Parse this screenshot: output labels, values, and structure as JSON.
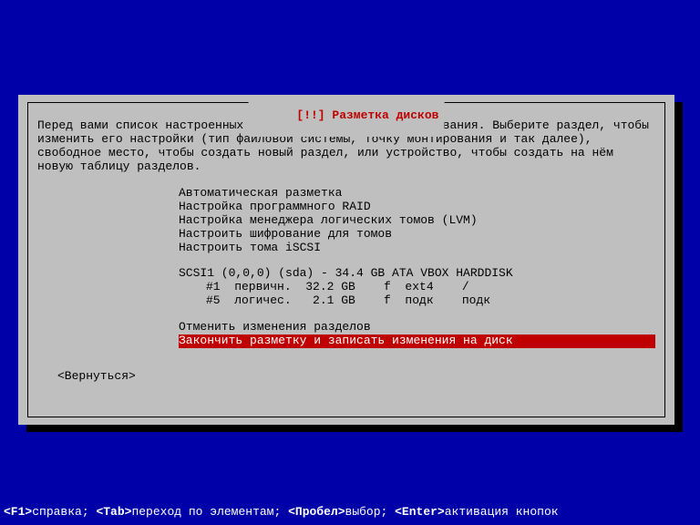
{
  "dialog": {
    "title": "[!!] Разметка дисков",
    "intro": "Перед вами список настроенных разделов и их точек монтирования. Выберите раздел, чтобы изменить его настройки (тип файловой системы, точку монтирования и так далее), свободное место, чтобы создать новый раздел, или устройство, чтобы создать на нём новую таблицу разделов.",
    "menu": {
      "auto": "Автоматическая разметка",
      "raid": "Настройка программного RAID",
      "lvm": "Настройка менеджера логических томов (LVM)",
      "encrypt": "Настроить шифрование для томов",
      "iscsi": "Настроить тома iSCSI",
      "disk": "SCSI1 (0,0,0) (sda) - 34.4 GB ATA VBOX HARDDISK",
      "part1": "#1  первичн.  32.2 GB    f  ext4    /",
      "part5": "#5  логичес.   2.1 GB    f  подк    подк",
      "undo": "Отменить изменения разделов",
      "finish": "Закончить разметку и записать изменения на диск"
    },
    "back": "<Вернуться>"
  },
  "footer": {
    "f1_key": "<F1>",
    "f1_label": "справка; ",
    "tab_key": "<Tab>",
    "tab_label": "переход по элементам; ",
    "space_key": "<Пробел>",
    "space_label": "выбор; ",
    "enter_key": "<Enter>",
    "enter_label": "активация кнопок"
  }
}
